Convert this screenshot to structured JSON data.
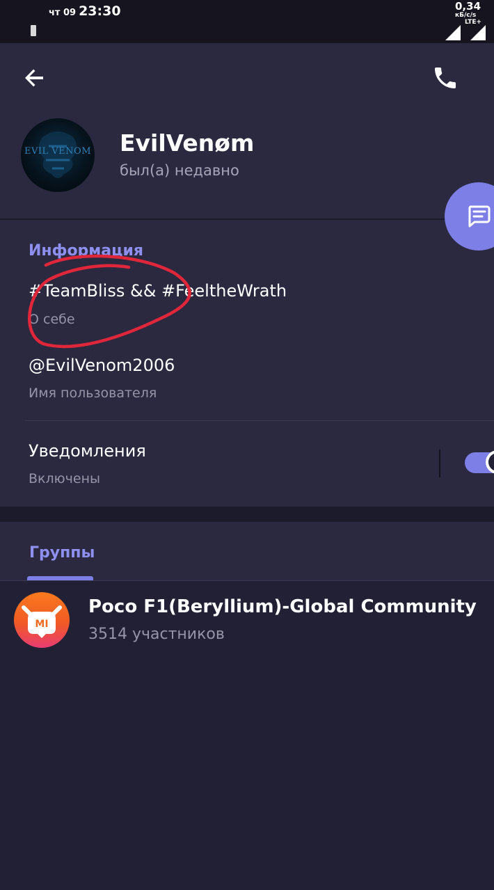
{
  "status_bar": {
    "day": "чт 09",
    "time": "23:30",
    "speed": "0,34",
    "speed_unit": "кБ/с/s",
    "network": "LTE+"
  },
  "profile": {
    "name": "EvilVenøm",
    "last_seen": "был(а) недавно",
    "avatar_text": "EVIL VENOM"
  },
  "info": {
    "section_title": "Информация",
    "bio": "#TeamBliss && #FeeltheWrath",
    "bio_label": "О себе",
    "username": "@EvilVenom2006",
    "username_label": "Имя пользователя",
    "notifications": "Уведомления",
    "notifications_state": "Включены",
    "notifications_on": true
  },
  "tabs": {
    "groups_label": "Группы"
  },
  "groups": [
    {
      "name": "Poco F1(Beryllium)-Global Community",
      "meta": "3514 участников",
      "avatar_text": "MI"
    }
  ],
  "colors": {
    "background": "#212035",
    "card": "#2a2940",
    "accent": "#7d7fe6",
    "annotation": "#e0263a"
  },
  "icons": {
    "back": "arrow-left-icon",
    "call": "phone-icon",
    "message": "message-icon"
  }
}
